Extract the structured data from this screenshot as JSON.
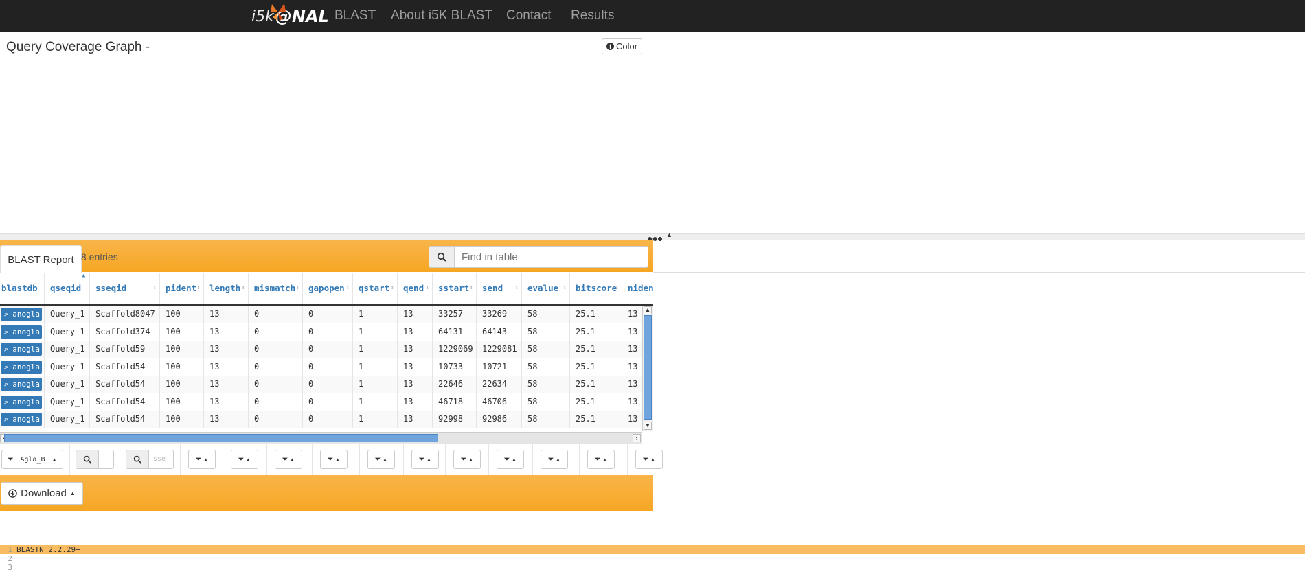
{
  "navbar": {
    "brand_i5k": "i5k",
    "brand_nal": "@NAL",
    "items": [
      "BLAST",
      "About i5K BLAST",
      "Contact",
      "Results"
    ]
  },
  "coverage": {
    "title": "Query Coverage Graph -",
    "color_button": "Color"
  },
  "report": {
    "tab_label": "BLAST Report",
    "entries_text": "8 entries",
    "search_placeholder": "Find in table",
    "columns": [
      "blastdb",
      "qseqid",
      "sseqid",
      "pident",
      "length",
      "mismatch",
      "gapopen",
      "qstart",
      "qend",
      "sstart",
      "send",
      "evalue",
      "bitscore",
      "niden"
    ],
    "rows": [
      {
        "blastdb": "anogla",
        "qseqid": "Query_1",
        "sseqid": "Scaffold8047",
        "pident": "100",
        "length": "13",
        "mismatch": "0",
        "gapopen": "0",
        "qstart": "1",
        "qend": "13",
        "sstart": "33257",
        "send": "33269",
        "evalue": "58",
        "bitscore": "25.1",
        "niden": "13"
      },
      {
        "blastdb": "anogla",
        "qseqid": "Query_1",
        "sseqid": "Scaffold374",
        "pident": "100",
        "length": "13",
        "mismatch": "0",
        "gapopen": "0",
        "qstart": "1",
        "qend": "13",
        "sstart": "64131",
        "send": "64143",
        "evalue": "58",
        "bitscore": "25.1",
        "niden": "13"
      },
      {
        "blastdb": "anogla",
        "qseqid": "Query_1",
        "sseqid": "Scaffold59",
        "pident": "100",
        "length": "13",
        "mismatch": "0",
        "gapopen": "0",
        "qstart": "1",
        "qend": "13",
        "sstart": "1229069",
        "send": "1229081",
        "evalue": "58",
        "bitscore": "25.1",
        "niden": "13"
      },
      {
        "blastdb": "anogla",
        "qseqid": "Query_1",
        "sseqid": "Scaffold54",
        "pident": "100",
        "length": "13",
        "mismatch": "0",
        "gapopen": "0",
        "qstart": "1",
        "qend": "13",
        "sstart": "10733",
        "send": "10721",
        "evalue": "58",
        "bitscore": "25.1",
        "niden": "13"
      },
      {
        "blastdb": "anogla",
        "qseqid": "Query_1",
        "sseqid": "Scaffold54",
        "pident": "100",
        "length": "13",
        "mismatch": "0",
        "gapopen": "0",
        "qstart": "1",
        "qend": "13",
        "sstart": "22646",
        "send": "22634",
        "evalue": "58",
        "bitscore": "25.1",
        "niden": "13"
      },
      {
        "blastdb": "anogla",
        "qseqid": "Query_1",
        "sseqid": "Scaffold54",
        "pident": "100",
        "length": "13",
        "mismatch": "0",
        "gapopen": "0",
        "qstart": "1",
        "qend": "13",
        "sstart": "46718",
        "send": "46706",
        "evalue": "58",
        "bitscore": "25.1",
        "niden": "13"
      },
      {
        "blastdb": "anogla",
        "qseqid": "Query_1",
        "sseqid": "Scaffold54",
        "pident": "100",
        "length": "13",
        "mismatch": "0",
        "gapopen": "0",
        "qstart": "1",
        "qend": "13",
        "sstart": "92998",
        "send": "92986",
        "evalue": "58",
        "bitscore": "25.1",
        "niden": "13"
      }
    ],
    "sort_column": "qseqid",
    "filter_blastdb_value": "Agla_B",
    "filter_sseqid_placeholder": "sse",
    "download_label": "Download"
  },
  "code": {
    "lines": [
      {
        "num": "1",
        "text": "BLASTN 2.2.29+"
      },
      {
        "num": "2",
        "text": ""
      },
      {
        "num": "3",
        "text": ""
      }
    ]
  },
  "colors": {
    "navbar": "#222222",
    "panel_orange": "#f6a623",
    "link_blue": "#337ab7",
    "code_highlight": "#f8bd63"
  }
}
